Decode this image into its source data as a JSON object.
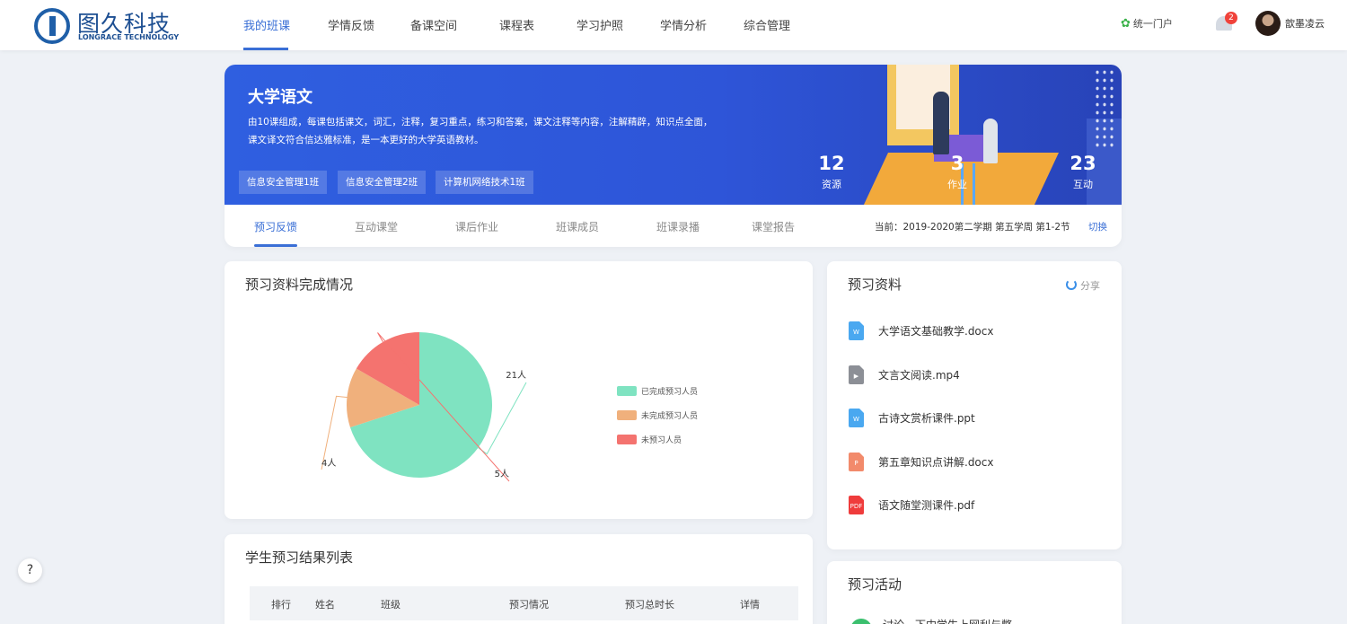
{
  "header": {
    "logo_name": "图久科技",
    "logo_sub": "LONGRACE TECHNOLOGY",
    "nav": [
      "我的班课",
      "学情反馈",
      "备课空间",
      "课程表",
      "学习护照",
      "学情分析",
      "综合管理"
    ],
    "portal": "统一门户",
    "portal_icon": "grid-icon",
    "notifications": "2",
    "username": "歆墨凌云",
    "accent_color": "#3a6fd6"
  },
  "banner": {
    "title": "大学语文",
    "description": "由10课组成，每课包括课文，词汇，注释，复习重点，练习和答案，课文注释等内容，注解精辟，知识点全面，课文译文符合信达雅标准，是一本更好的大学英语教材。",
    "classes": [
      "信息安全管理1班",
      "信息安全管理2班",
      "计算机网络技术1班"
    ],
    "stats": [
      {
        "value": "12",
        "label": "资源"
      },
      {
        "value": "3",
        "label": "作业"
      },
      {
        "value": "23",
        "label": "互动"
      }
    ]
  },
  "tabs": {
    "items": [
      "预习反馈",
      "互动课堂",
      "课后作业",
      "班课成员",
      "班课录播",
      "课堂报告"
    ],
    "active": "预习反馈",
    "term": "当前：2019-2020第二学期  第五学周  第1-2节",
    "switch_label": "切换"
  },
  "completion_card": {
    "title": "预习资料完成情况"
  },
  "chart_data": {
    "type": "pie",
    "series": [
      {
        "name": "已完成预习人员",
        "value": 21,
        "label": "21人",
        "color": "#7fe3c1"
      },
      {
        "name": "未完成预习人员",
        "value": 4,
        "label": "4人",
        "color": "#f0b07c"
      },
      {
        "name": "未预习人员",
        "value": 5,
        "label": "5人",
        "color": "#f4736f"
      }
    ],
    "legend_position": "right"
  },
  "materials": {
    "title": "预习资料",
    "share_label": "分享",
    "files": [
      {
        "name": "大学语文基础教学.docx",
        "icon": "word-icon",
        "glyph": "W",
        "color": "#4aa8f0"
      },
      {
        "name": "文言文阅读.mp4",
        "icon": "video-icon",
        "glyph": "▶",
        "color": "#8c8f96"
      },
      {
        "name": "古诗文赏析课件.ppt",
        "icon": "word-icon",
        "glyph": "W",
        "color": "#4aa8f0"
      },
      {
        "name": "第五章知识点讲解.docx",
        "icon": "ppt-icon",
        "glyph": "P",
        "color": "#f28a6b"
      },
      {
        "name": "语文随堂测课件.pdf",
        "icon": "pdf-icon",
        "glyph": "PDF",
        "color": "#ef3c3c"
      }
    ]
  },
  "results": {
    "title": "学生预习结果列表",
    "columns": [
      "排行",
      "姓名",
      "班级",
      "预习情况",
      "预习总时长",
      "详情"
    ]
  },
  "activity": {
    "title": "预习活动",
    "first_item": "讨论一下中学生上网利与弊"
  },
  "help_label": "?"
}
